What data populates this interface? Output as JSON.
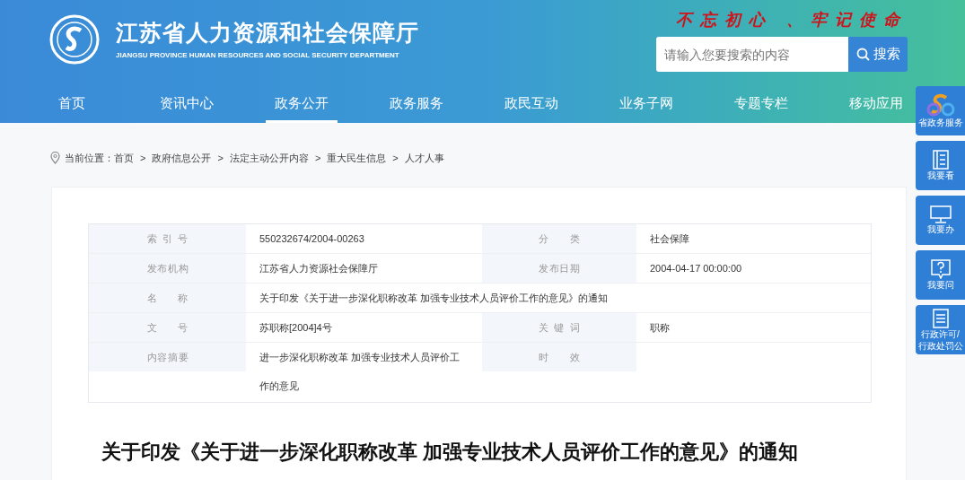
{
  "header": {
    "title": "江苏省人力资源和社会保障厅",
    "subtitle": "JIANGSU PROVINCE HUMAN RESOURCES AND SOCIAL SECURITY DEPARTMENT",
    "slogan": "不忘初心 、牢记使命",
    "search": {
      "placeholder": "请输入您要搜索的内容",
      "button": "搜索"
    }
  },
  "nav": [
    {
      "label": "首页",
      "selected": false
    },
    {
      "label": "资讯中心",
      "selected": false
    },
    {
      "label": "政务公开",
      "selected": true
    },
    {
      "label": "政务服务",
      "selected": false
    },
    {
      "label": "政民互动",
      "selected": false
    },
    {
      "label": "业务子网",
      "selected": false
    },
    {
      "label": "专题专栏",
      "selected": false
    },
    {
      "label": "移动应用",
      "selected": false
    }
  ],
  "breadcrumb": {
    "label": "当前位置：",
    "items": [
      "首页",
      "政府信息公开",
      "法定主动公开内容",
      "重大民生信息",
      "人才人事"
    ],
    "separator": ">"
  },
  "info_table": {
    "rows": [
      {
        "label": "索 引 号",
        "value": "550232674/2004-00263",
        "label_2": "分 类",
        "value_2": "社会保障"
      },
      {
        "label": "发布机构",
        "value": "江苏省人力资源社会保障厅",
        "label_2": "发布日期",
        "value_2": "2004-04-17 00:00:00"
      },
      {
        "label": "名 称",
        "value": "关于印发《关于进一步深化职称改革 加强专业技术人员评价工作的意见》的通知"
      },
      {
        "label": "文 号",
        "value": "苏职称[2004]4号",
        "label_2": "关 键 词",
        "value_2": "职称"
      },
      {
        "label": "内容摘要",
        "value": "进一步深化职称改革 加强专业技术人员评价工作的意见",
        "label_2": "时 效"
      }
    ]
  },
  "article": {
    "title": "关于印发《关于进一步深化职称改革 加强专业技术人员评价工作的意见》的通知"
  },
  "side_bar": [
    {
      "kind": "logo",
      "lines": [
        "省政务服务"
      ]
    },
    {
      "kind": "book",
      "lines": [
        "我要看"
      ]
    },
    {
      "kind": "monitor",
      "lines": [
        "我要办"
      ]
    },
    {
      "kind": "question",
      "lines": [
        "我要问"
      ]
    },
    {
      "kind": "document",
      "lines": [
        "行政许可/",
        "行政处罚公"
      ]
    }
  ]
}
